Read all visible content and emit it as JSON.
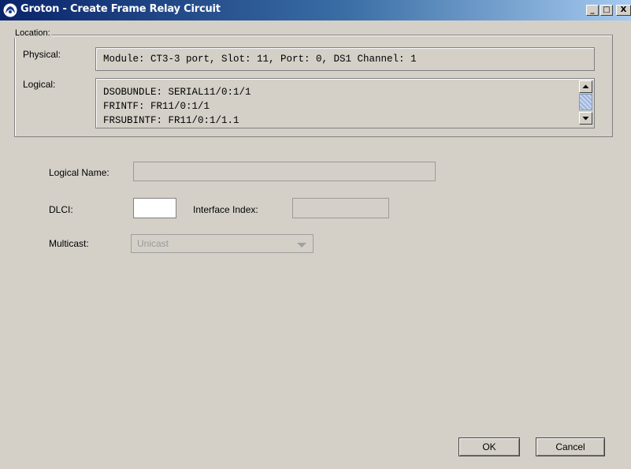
{
  "window": {
    "title": "Groton - Create Frame Relay Circuit",
    "controls": {
      "minimize": "_",
      "maximize": "□",
      "close": "X"
    }
  },
  "location": {
    "legend": "Location:",
    "physical_label": "Physical:",
    "physical_value": "Module: CT3-3 port, Slot: 11, Port: 0, DS1 Channel: 1",
    "logical_label": "Logical:",
    "logical_lines": [
      "DSOBUNDLE: SERIAL11/0:1/1",
      "FRINTF: FR11/0:1/1",
      "FRSUBINTF: FR11/0:1/1.1"
    ]
  },
  "form": {
    "logical_name_label": "Logical Name:",
    "logical_name_value": "",
    "dlci_label": "DLCI:",
    "dlci_value": "",
    "interface_index_label": "Interface Index:",
    "interface_index_value": "",
    "multicast_label": "Multicast:",
    "multicast_value": "Unicast"
  },
  "buttons": {
    "ok": "OK",
    "cancel": "Cancel"
  }
}
